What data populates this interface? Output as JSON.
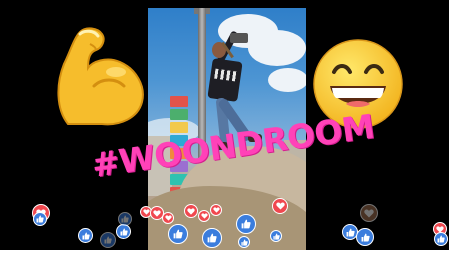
{
  "overlay": {
    "hashtag": "#WOONDROOM"
  },
  "stickers": {
    "left": "flexed-biceps-emoji",
    "right": "grinning-squinting-face-emoji"
  },
  "reactions": {
    "like_icon": "thumbs-up-icon",
    "love_icon": "heart-icon",
    "like_color": "#3b7ddd",
    "love_color": "#f0484f"
  },
  "colors": {
    "hashtag": "#ff42b8",
    "letterbox": "#000000"
  }
}
